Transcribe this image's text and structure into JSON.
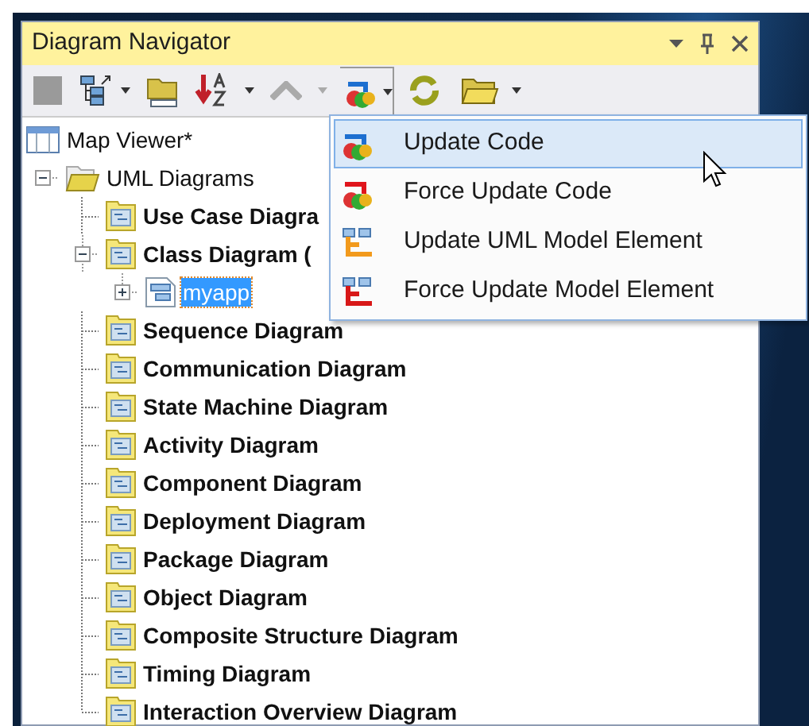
{
  "panel": {
    "title": "Diagram Navigator"
  },
  "tree": [
    {
      "label": "Map Viewer*",
      "kind": "viewer",
      "selected": false
    },
    {
      "label": "UML Diagrams",
      "kind": "folder",
      "expanded": true,
      "selected": false,
      "children": [
        {
          "label": "Use Case Diagra",
          "kind": "diagram",
          "selected": false
        },
        {
          "label": "Class Diagram (",
          "kind": "diagram",
          "expanded": true,
          "selected": false,
          "children": [
            {
              "label": "myapp",
              "kind": "model",
              "expanded": false,
              "selected": true
            }
          ]
        },
        {
          "label": "Sequence Diagram",
          "kind": "diagram",
          "selected": false
        },
        {
          "label": "Communication Diagram",
          "kind": "diagram",
          "selected": false
        },
        {
          "label": "State Machine Diagram",
          "kind": "diagram",
          "selected": false
        },
        {
          "label": "Activity Diagram",
          "kind": "diagram",
          "selected": false
        },
        {
          "label": "Component Diagram",
          "kind": "diagram",
          "selected": false
        },
        {
          "label": "Deployment Diagram",
          "kind": "diagram",
          "selected": false
        },
        {
          "label": "Package Diagram",
          "kind": "diagram",
          "selected": false
        },
        {
          "label": "Object Diagram",
          "kind": "diagram",
          "selected": false
        },
        {
          "label": "Composite Structure Diagram",
          "kind": "diagram",
          "selected": false
        },
        {
          "label": "Timing Diagram",
          "kind": "diagram",
          "selected": false
        },
        {
          "label": "Interaction Overview Diagram",
          "kind": "diagram",
          "selected": false
        }
      ]
    }
  ],
  "menu": [
    {
      "label": "Update Code",
      "kind": "update",
      "selected": true
    },
    {
      "label": "Force Update Code",
      "kind": "force-update",
      "selected": false
    },
    {
      "label": "Update UML Model Element",
      "kind": "model-update",
      "selected": false
    },
    {
      "label": "Force Update Model Element",
      "kind": "force-model-update",
      "selected": false
    }
  ]
}
